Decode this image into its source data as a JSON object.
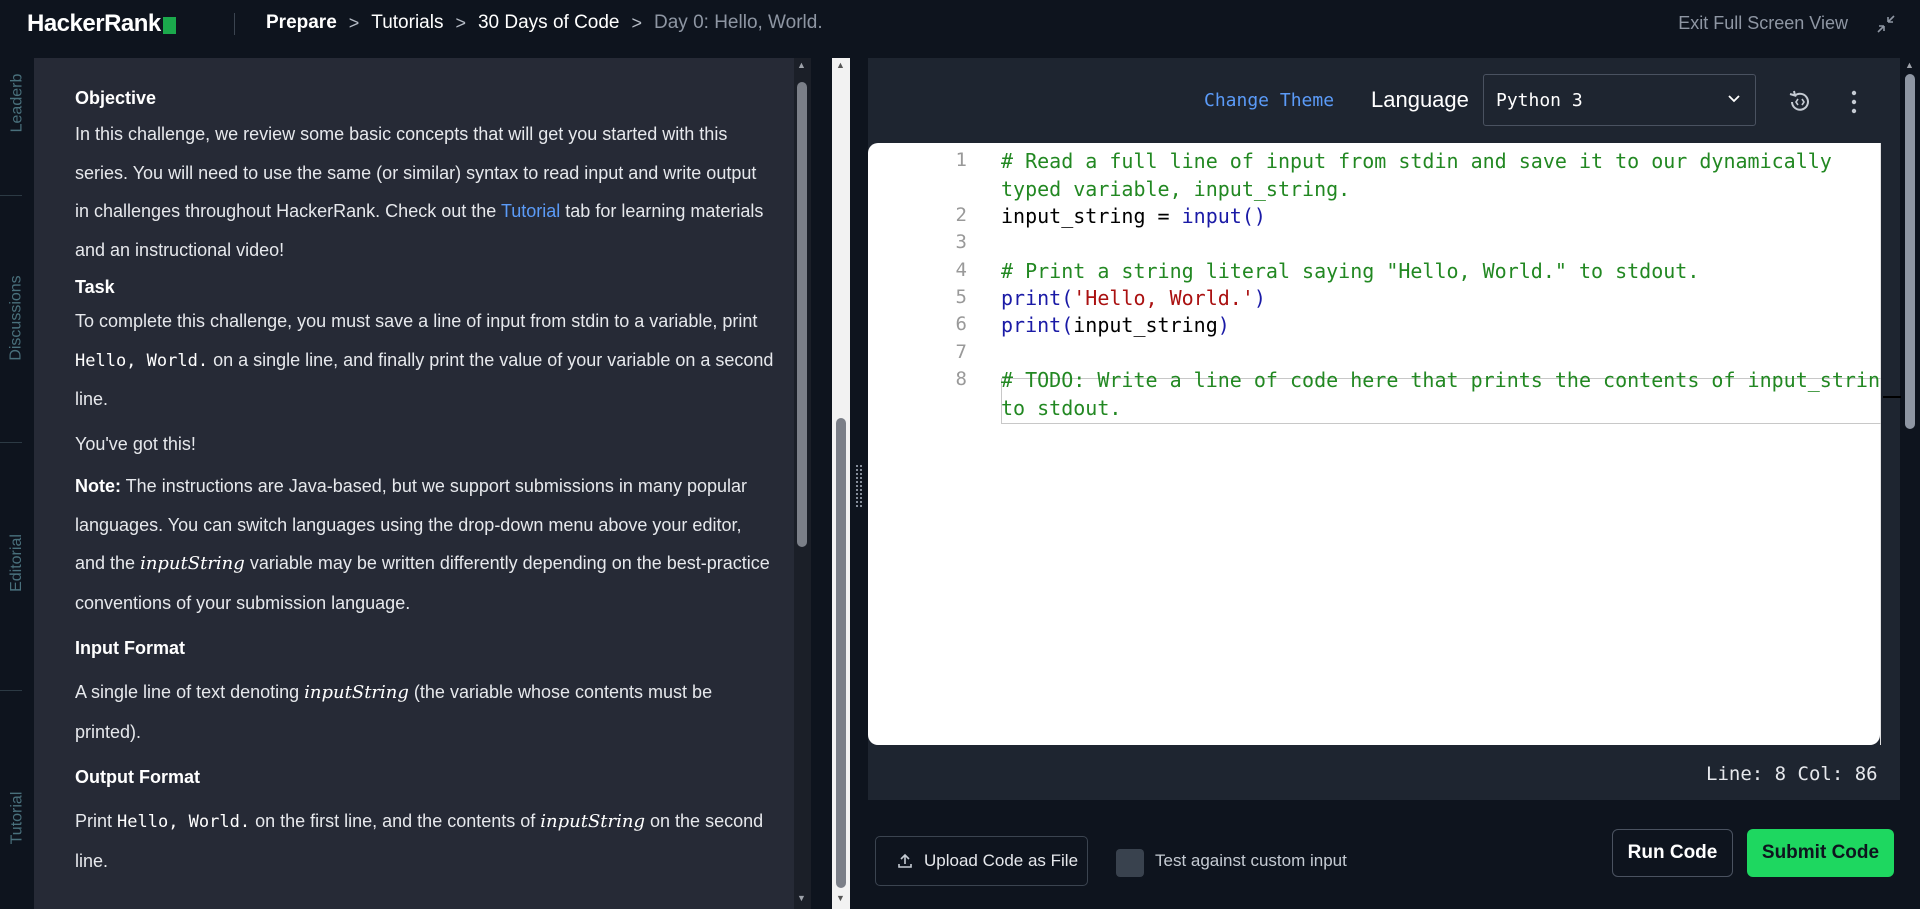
{
  "header": {
    "logo_text": "HackerRank",
    "breadcrumbs": [
      "Prepare",
      "Tutorials",
      "30 Days of Code",
      "Day 0: Hello, World."
    ],
    "exit_fullscreen_label": "Exit Full Screen View"
  },
  "rail": {
    "tabs": [
      "Leaderb",
      "Discussions",
      "Editorial",
      "Tutorial"
    ]
  },
  "problem": {
    "objective_heading": "Objective",
    "objective_text_1": "In this challenge, we review some basic concepts that will get you started with this series. You will need to use the same (or similar) syntax to read input and write output in challenges throughout HackerRank. Check out the ",
    "objective_link": "Tutorial",
    "objective_text_2": " tab for learning materials and an instructional video!",
    "task_heading": "Task",
    "task_text_1": "To complete this challenge, you must save a line of input from stdin to a variable, print ",
    "task_code": "Hello, World.",
    "task_text_2": " on a single line, and finally print the value of your variable on a second line.",
    "encourage": "You've got this!",
    "note_label": "Note:",
    "note_text_1": " The instructions are Java-based, but we support submissions in many popular languages. You can switch languages using the drop-down menu above your editor, and the ",
    "note_var": "inputString",
    "note_text_2": " variable may be written differently depending on the best-practice conventions of your submission language.",
    "input_heading": "Input Format",
    "input_text_1": "A single line of text denoting ",
    "input_var": "inputString",
    "input_text_2": " (the variable whose contents must be printed).",
    "output_heading": "Output Format",
    "output_text_1": "Print ",
    "output_code": "Hello, World.",
    "output_text_2": " on the first line, and the contents of ",
    "output_var": "inputString",
    "output_text_3": " on the second line."
  },
  "editor": {
    "change_theme_label": "Change Theme",
    "language_label": "Language",
    "language_value": "Python 3",
    "line_numbers": [
      "1",
      "2",
      "3",
      "4",
      "5",
      "6",
      "7",
      "8"
    ],
    "code": {
      "l1a": "# Read a full line of input from stdin and save it to our dynamically",
      "l1b": "typed variable, input_string.",
      "l2_var": "input_string = ",
      "l2_fn": "input",
      "l2_paren": "()",
      "l4": "# Print a string literal saying \"Hello, World.\" to stdout.",
      "l5_fn": "print",
      "l5_open": "(",
      "l5_str": "'Hello, World.'",
      "l5_close": ")",
      "l6_fn": "print",
      "l6_open": "(",
      "l6_arg": "input_string",
      "l6_close": ")",
      "l8a": "# TODO: Write a line of code here that prints the contents of input_strin",
      "l8b": "to stdout."
    },
    "status": "Line: 8 Col: 86"
  },
  "footer": {
    "upload_label": "Upload Code as File",
    "custom_input_label": "Test against custom input",
    "run_label": "Run Code",
    "submit_label": "Submit Code"
  },
  "colors": {
    "accent_green": "#1ed760",
    "link_blue": "#5b9bf8",
    "background": "#0e141e",
    "panel": "#262a36"
  }
}
